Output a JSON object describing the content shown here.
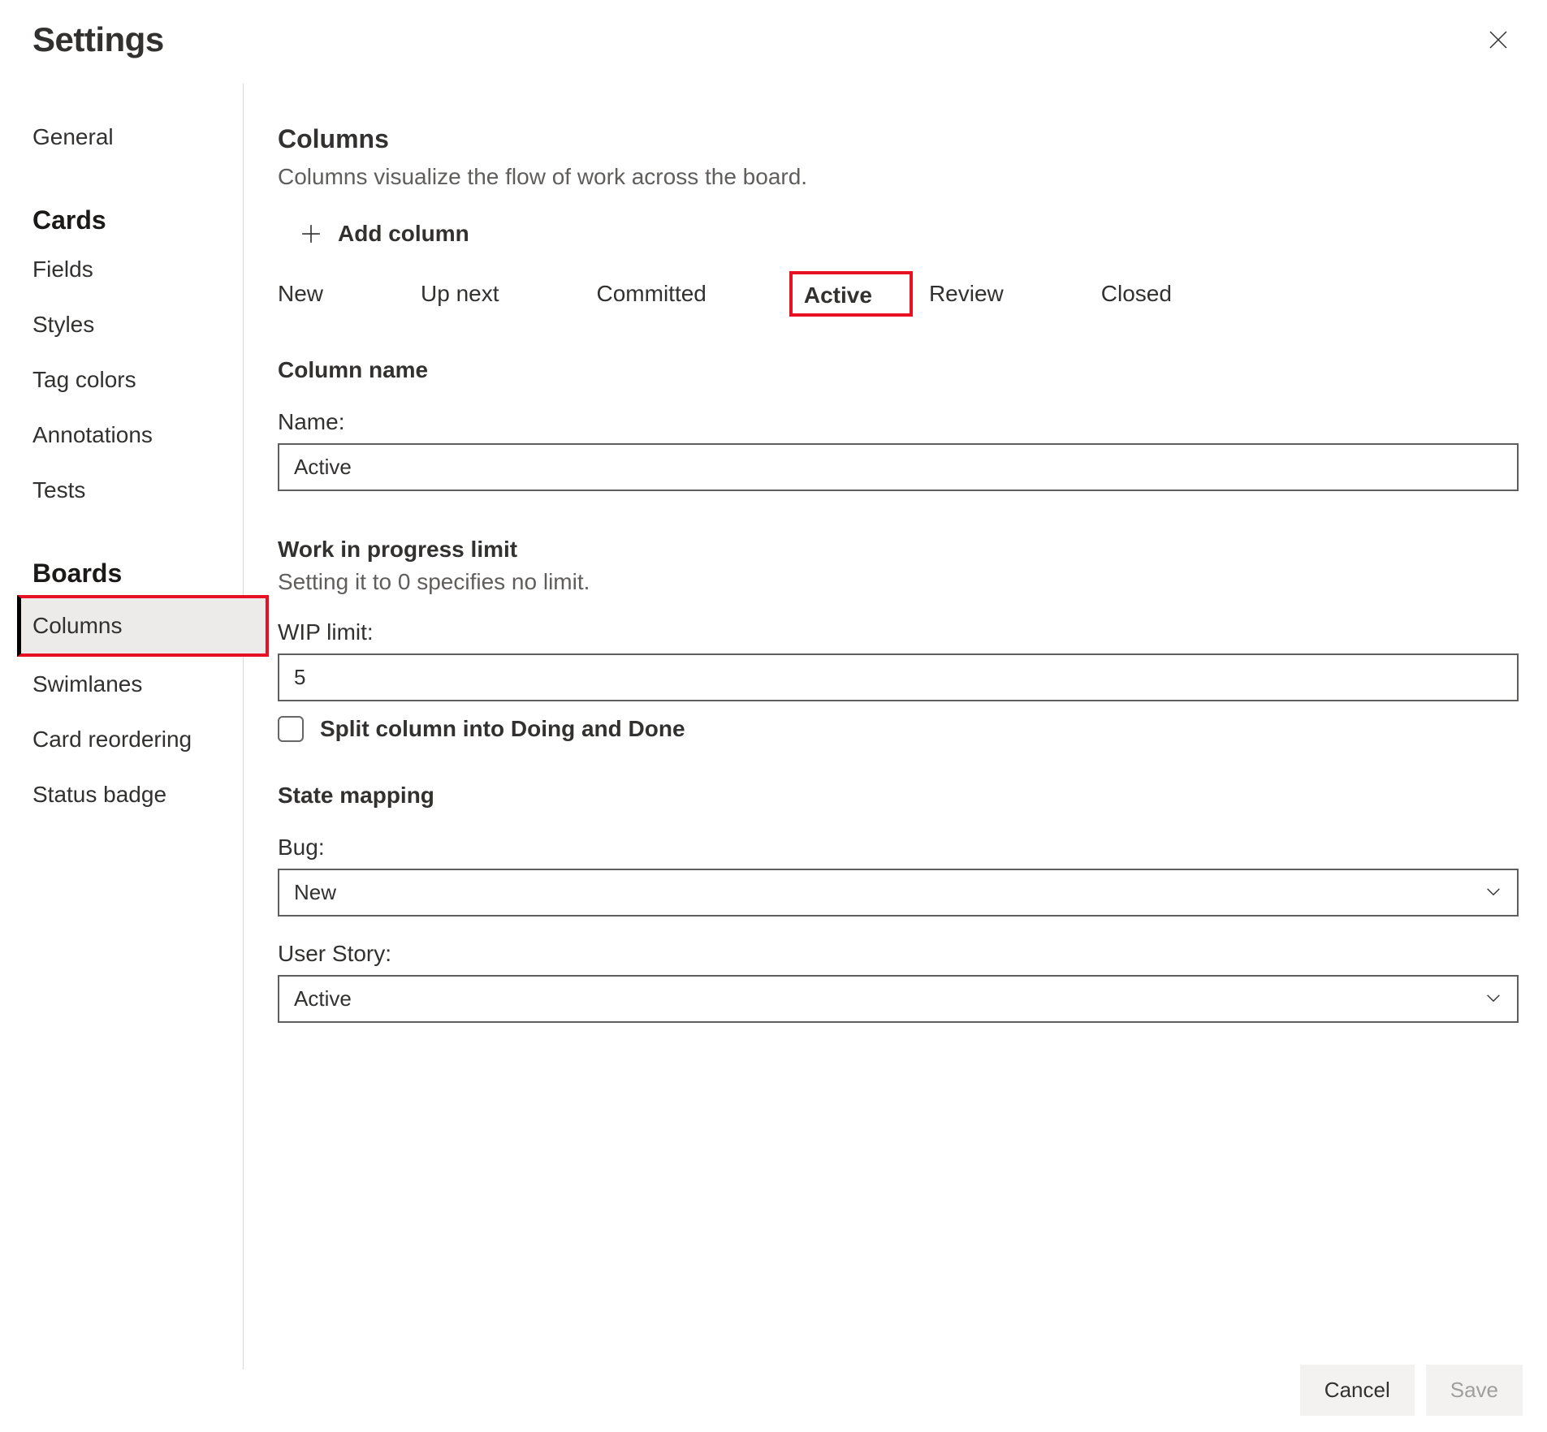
{
  "header": {
    "title": "Settings"
  },
  "sidebar": {
    "general": "General",
    "groups": [
      {
        "heading": "Cards",
        "items": [
          {
            "label": "Fields"
          },
          {
            "label": "Styles"
          },
          {
            "label": "Tag colors"
          },
          {
            "label": "Annotations"
          },
          {
            "label": "Tests"
          }
        ]
      },
      {
        "heading": "Boards",
        "items": [
          {
            "label": "Columns"
          },
          {
            "label": "Swimlanes"
          },
          {
            "label": "Card reordering"
          },
          {
            "label": "Status badge"
          }
        ]
      }
    ]
  },
  "main": {
    "title": "Columns",
    "description": "Columns visualize the flow of work across the board.",
    "add_column_label": "Add column",
    "tabs": [
      {
        "label": "New"
      },
      {
        "label": "Up next"
      },
      {
        "label": "Committed"
      },
      {
        "label": "Active"
      },
      {
        "label": "Review"
      },
      {
        "label": "Closed"
      }
    ],
    "column_name_section": {
      "heading": "Column name",
      "label": "Name:",
      "value": "Active"
    },
    "wip_section": {
      "heading": "Work in progress limit",
      "description": "Setting it to 0 specifies no limit.",
      "label": "WIP limit:",
      "value": "5",
      "split_label": "Split column into Doing and Done",
      "split_checked": false
    },
    "state_mapping": {
      "heading": "State mapping",
      "bug_label": "Bug:",
      "bug_value": "New",
      "user_story_label": "User Story:",
      "user_story_value": "Active"
    }
  },
  "footer": {
    "cancel": "Cancel",
    "save": "Save"
  }
}
